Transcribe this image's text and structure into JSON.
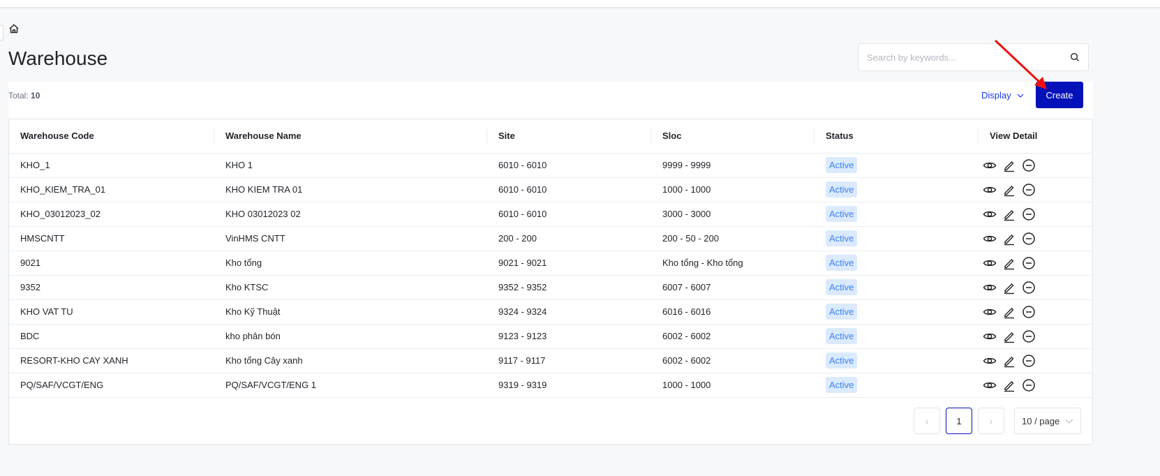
{
  "page": {
    "title": "Warehouse",
    "total_label": "Total:",
    "total_value": "10"
  },
  "search": {
    "placeholder": "Search by keywords..."
  },
  "toolbar": {
    "display_label": "Display",
    "create_label": "Create"
  },
  "table": {
    "columns": [
      "Warehouse Code",
      "Warehouse Name",
      "Site",
      "Sloc",
      "Status",
      "View Detail"
    ],
    "rows": [
      [
        "KHO_1",
        "KHO 1",
        "6010 - 6010",
        "9999 - 9999",
        "Active"
      ],
      [
        "KHO_KIEM_TRA_01",
        "KHO KIEM TRA 01",
        "6010 - 6010",
        "1000 - 1000",
        "Active"
      ],
      [
        "KHO_03012023_02",
        "KHO 03012023 02",
        "6010 - 6010",
        "3000 - 3000",
        "Active"
      ],
      [
        "HMSCNTT",
        "VinHMS CNTT",
        "200 - 200",
        "200 - 50 - 200",
        "Active"
      ],
      [
        "9021",
        "Kho tổng",
        "9021 - 9021",
        "Kho tổng - Kho tổng",
        "Active"
      ],
      [
        "9352",
        "Kho KTSC",
        "9352 - 9352",
        "6007 - 6007",
        "Active"
      ],
      [
        "KHO VAT TU",
        "Kho Kỹ Thuật",
        "9324 - 9324",
        "6016 - 6016",
        "Active"
      ],
      [
        "BDC",
        "kho phân bón",
        "9123 - 9123",
        "6002 - 6002",
        "Active"
      ],
      [
        "RESORT-KHO CAY XANH",
        "Kho tổng Cây xanh",
        "9117 - 9117",
        "6002 - 6002",
        "Active"
      ],
      [
        "PQ/SAF/VCGT/ENG",
        "PQ/SAF/VCGT/ENG 1",
        "9319 - 9319",
        "1000 - 1000",
        "Active"
      ]
    ]
  },
  "pagination": {
    "current_page": "1",
    "page_size": "10 / page"
  },
  "colors": {
    "primary": "#0312b8",
    "badge_bg": "#dbeafe",
    "badge_text": "#3b82f6",
    "annotation": "#ee1111"
  }
}
